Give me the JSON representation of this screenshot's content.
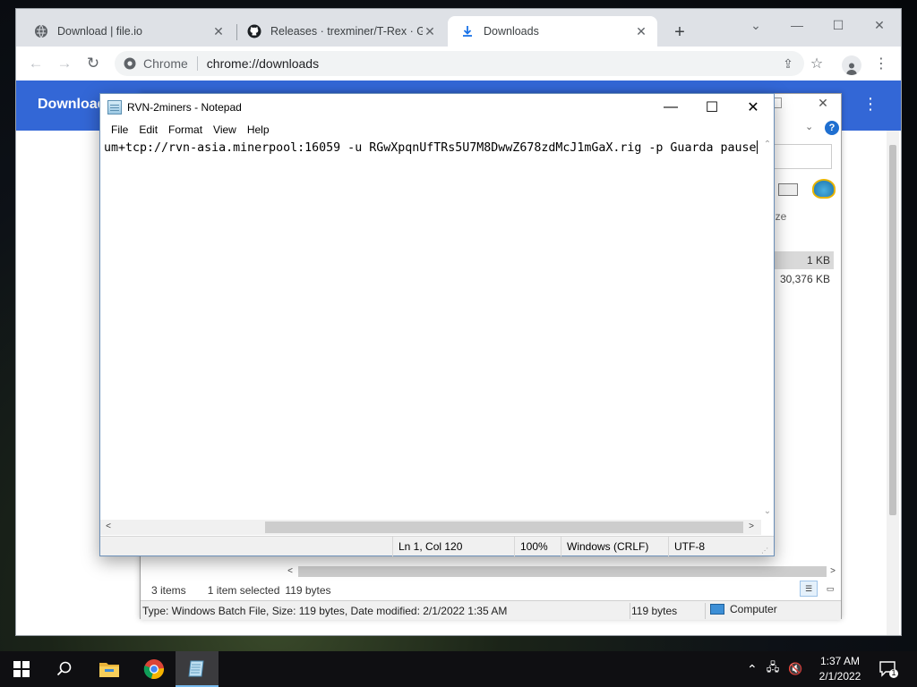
{
  "chrome": {
    "tabs": [
      {
        "title": "Download | file.io",
        "icon": "globe-icon"
      },
      {
        "title": "Releases · trexminer/T-Rex · GitHub",
        "icon": "github-icon"
      },
      {
        "title": "Downloads",
        "icon": "download-icon"
      }
    ],
    "new_tab": "+",
    "omnibox": {
      "chip": "Chrome",
      "url": "chrome://downloads"
    },
    "page_title": "Downloads"
  },
  "explorer": {
    "size_header": "ize",
    "rows": [
      "1 KB",
      "30,376 KB"
    ],
    "status": {
      "items": "3 items",
      "selected": "1 item selected",
      "size": "119 bytes"
    },
    "infobar": {
      "details": "Type: Windows Batch File, Size: 119 bytes, Date modified: 2/1/2022 1:35 AM",
      "size": "119 bytes",
      "location": "Computer"
    }
  },
  "notepad": {
    "title": "RVN-2miners - Notepad",
    "menu": [
      "File",
      "Edit",
      "Format",
      "View",
      "Help"
    ],
    "content": "um+tcp://rvn-asia.minerpool:16059 -u RGwXpqnUfTRs5U7M8DwwZ678zdMcJ1mGaX.rig -p Guarda pause",
    "status": {
      "position": "Ln 1, Col 120",
      "zoom": "100%",
      "line_ending": "Windows (CRLF)",
      "encoding": "UTF-8"
    }
  },
  "taskbar": {
    "apps": [
      "start-icon",
      "search-icon",
      "file-explorer-icon",
      "chrome-icon",
      "notepad-icon"
    ],
    "clock": {
      "time": "1:37 AM",
      "date": "2/1/2022"
    },
    "notifications": "1"
  }
}
